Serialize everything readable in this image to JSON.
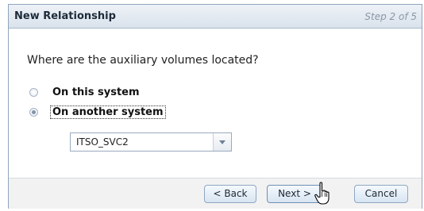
{
  "dialog": {
    "title": "New Relationship",
    "step": "Step 2 of 5",
    "question": "Where are the auxiliary volumes located?",
    "options": [
      {
        "label": "On this system",
        "checked": false
      },
      {
        "label": "On another system",
        "checked": true
      }
    ],
    "system_select": {
      "value": "ITSO_SVC2"
    },
    "buttons": {
      "back": "< Back",
      "next": "Next >",
      "cancel": "Cancel"
    }
  },
  "icons": {
    "cursor": "hand-pointer-icon",
    "dropdown": "chevron-down-icon"
  }
}
